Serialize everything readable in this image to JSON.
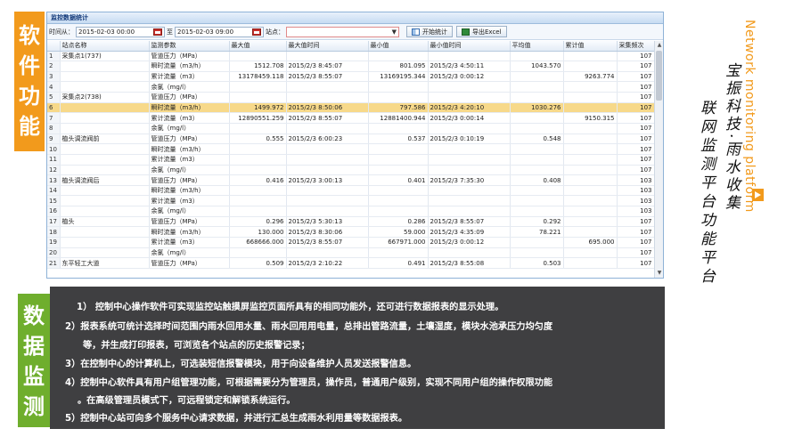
{
  "side_labels": {
    "top": [
      "软",
      "件",
      "功",
      "能"
    ],
    "bottom": [
      "数",
      "据",
      "监",
      "测"
    ]
  },
  "window": {
    "title": "监控数据统计",
    "toolbar": {
      "from_label": "时间从：",
      "from_value": "2015-02-03 00:00",
      "to_label": "至",
      "to_value": "2015-02-03 09:00",
      "station_label": "站点：",
      "station_value": "",
      "stat_button": "开始统计",
      "export_button": "导出Excel"
    },
    "columns": [
      "",
      "站点名称",
      "监测参数",
      "最大值",
      "最大值时间",
      "最小值",
      "最小值时间",
      "平均值",
      "累计值",
      "采集频次"
    ],
    "rows": [
      [
        "1",
        "采集点1(737)",
        "管道压力（MPa）",
        "",
        "",
        "",
        "",
        "",
        "",
        "107"
      ],
      [
        "2",
        "",
        "瞬时流量（m3/h）",
        "1512.708",
        "2015/2/3 8:45:07",
        "801.095",
        "2015/2/3 4:50:11",
        "1043.570",
        "",
        "107"
      ],
      [
        "3",
        "",
        "累计流量（m3）",
        "13178459.118",
        "2015/2/3 8:55:07",
        "13169195.344",
        "2015/2/3 0:00:12",
        "",
        "9263.774",
        "107"
      ],
      [
        "4",
        "",
        "余氯（mg/l）",
        "",
        "",
        "",
        "",
        "",
        "",
        "107"
      ],
      [
        "5",
        "采集点2(738)",
        "管道压力（MPa）",
        "",
        "",
        "",
        "",
        "",
        "",
        "107"
      ],
      [
        "6",
        "",
        "瞬时流量（m3/h）",
        "1499.972",
        "2015/2/3 8:50:06",
        "797.586",
        "2015/2/3 4:20:10",
        "1030.276",
        "",
        "107"
      ],
      [
        "7",
        "",
        "累计流量（m3）",
        "12890551.259",
        "2015/2/3 8:55:07",
        "12881400.944",
        "2015/2/3 0:00:14",
        "",
        "9150.315",
        "107"
      ],
      [
        "8",
        "",
        "余氯（mg/l）",
        "",
        "",
        "",
        "",
        "",
        "",
        "107"
      ],
      [
        "9",
        "植头调流阀前",
        "管道压力（MPa）",
        "0.555",
        "2015/2/3 6:00:23",
        "0.537",
        "2015/2/3 0:10:19",
        "0.548",
        "",
        "107"
      ],
      [
        "10",
        "",
        "瞬时流量（m3/h）",
        "",
        "",
        "",
        "",
        "",
        "",
        "107"
      ],
      [
        "11",
        "",
        "累计流量（m3）",
        "",
        "",
        "",
        "",
        "",
        "",
        "107"
      ],
      [
        "12",
        "",
        "余氯（mg/l）",
        "",
        "",
        "",
        "",
        "",
        "",
        "107"
      ],
      [
        "13",
        "植头调流阀后",
        "管道压力（MPa）",
        "0.416",
        "2015/2/3 3:00:13",
        "0.401",
        "2015/2/3 7:35:30",
        "0.408",
        "",
        "103"
      ],
      [
        "14",
        "",
        "瞬时流量（m3/h）",
        "",
        "",
        "",
        "",
        "",
        "",
        "103"
      ],
      [
        "15",
        "",
        "累计流量（m3）",
        "",
        "",
        "",
        "",
        "",
        "",
        "103"
      ],
      [
        "16",
        "",
        "余氯（mg/l）",
        "",
        "",
        "",
        "",
        "",
        "",
        "103"
      ],
      [
        "17",
        "植头",
        "管道压力（MPa）",
        "0.296",
        "2015/2/3 5:30:13",
        "0.286",
        "2015/2/3 8:55:07",
        "0.292",
        "",
        "107"
      ],
      [
        "18",
        "",
        "瞬时流量（m3/h）",
        "130.000",
        "2015/2/3 8:30:06",
        "59.000",
        "2015/2/3 4:35:09",
        "78.221",
        "",
        "107"
      ],
      [
        "19",
        "",
        "累计流量（m3）",
        "668666.000",
        "2015/2/3 8:55:07",
        "667971.000",
        "2015/2/3 0:00:12",
        "",
        "695.000",
        "107"
      ],
      [
        "20",
        "",
        "余氯（mg/l）",
        "",
        "",
        "",
        "",
        "",
        "",
        "107"
      ],
      [
        "21",
        "东平轻工大道",
        "管道压力（MPa）",
        "0.509",
        "2015/2/3 2:10:22",
        "0.491",
        "2015/2/3 8:55:08",
        "0.503",
        "",
        "107"
      ]
    ],
    "selected_row": 5
  },
  "panel_lines": [
    "1） 控制中心操作软件可实现监控站触摸屏监控页面所具有的相同功能外，还可进行数据报表的显示处理。",
    "2）报表系统可统计选择时间范围内雨水回用水量、雨水回用用电量，总排出管路流量，土壤湿度，模块水池承压力均匀度",
    "等，并生成打印报表，可浏览各个站点的历史报警记录；",
    "3）在控制中心的计算机上，可选装短信报警模块，用于向设备维护人员发送报警信息。",
    "4）控制中心软件具有用户组管理功能，可根据需要分为管理员，操作员，普通用户级别，实现不同用户组的操作权限功能",
    "。在高级管理员模式下，可远程锁定和解锁系统运行。",
    "5）控制中心站可向多个服务中心请求数据，并进行汇总生成雨水利用量等数据报表。"
  ],
  "right_text": {
    "english": "Network monitoring platform",
    "cn_line1": "宝振科技·雨水收集",
    "cn_line2": "联网监测平台功能平台"
  },
  "colors": {
    "orange": "#f29a1c",
    "green": "#6fae2d",
    "panel": "#3f3f41",
    "selected_row": "#f7d98a"
  }
}
